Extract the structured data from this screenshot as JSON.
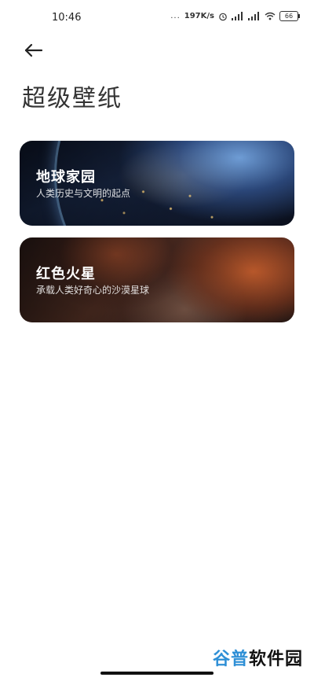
{
  "status_bar": {
    "time": "10:46",
    "dots": "...",
    "network_speed": "197K/s",
    "battery": "66"
  },
  "header": {
    "back_icon": "arrow-left-icon",
    "title": "超级壁纸"
  },
  "wallpapers": [
    {
      "title": "地球家园",
      "subtitle": "人类历史与文明的起点"
    },
    {
      "title": "红色火星",
      "subtitle": "承载人类好奇心的沙漠星球"
    }
  ],
  "watermark": {
    "part1": "谷普",
    "part2": "软件园"
  },
  "colors": {
    "watermark_accent": "#2e8fd6"
  }
}
